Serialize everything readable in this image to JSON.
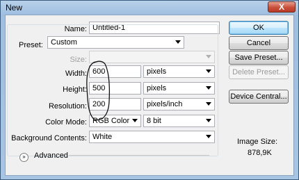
{
  "window": {
    "title": "New",
    "close_glyph": "X"
  },
  "form": {
    "name_label": "Name:",
    "name_value": "Untitled-1",
    "preset_label": "Preset:",
    "preset_value": "Custom",
    "size_label": "Size:",
    "width_label": "Width:",
    "width_value": "600",
    "width_unit": "pixels",
    "height_label": "Height:",
    "height_value": "500",
    "height_unit": "pixels",
    "resolution_label": "Resolution:",
    "resolution_value": "200",
    "resolution_unit": "pixels/inch",
    "color_mode_label": "Color Mode:",
    "color_mode_value": "RGB Color",
    "bit_depth_value": "8 bit",
    "background_label": "Background Contents:",
    "background_value": "White",
    "advanced_label": "Advanced"
  },
  "buttons": {
    "ok": "OK",
    "cancel": "Cancel",
    "save_preset": "Save Preset...",
    "delete_preset": "Delete Preset...",
    "device_central": "Device Central..."
  },
  "image_size": {
    "label": "Image Size:",
    "value": "878,9K"
  }
}
